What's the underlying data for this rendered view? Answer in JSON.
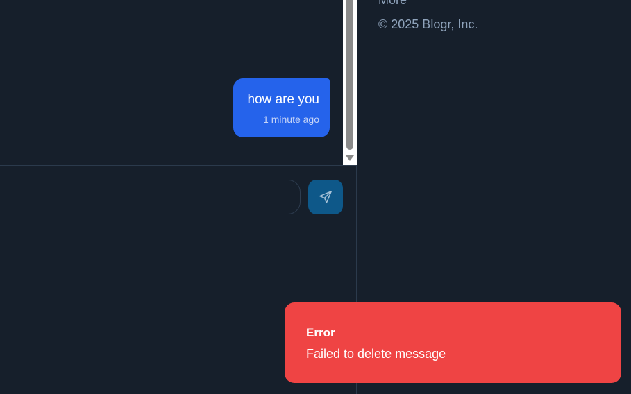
{
  "chat": {
    "messages": [
      {
        "text": "how are you",
        "time": "1 minute ago",
        "sender": "self"
      }
    ],
    "composer": {
      "input_value": "",
      "input_placeholder": "",
      "send_icon": "send-icon"
    }
  },
  "sidebar": {
    "more_label": "More",
    "copyright": "© 2025 Blogr, Inc."
  },
  "toast": {
    "title": "Error",
    "message": "Failed to delete message"
  },
  "colors": {
    "background": "#161f2b",
    "bubble": "#2563eb",
    "send_button": "#0e5889",
    "toast": "#ef4444",
    "muted_text": "#8fa3bb"
  }
}
